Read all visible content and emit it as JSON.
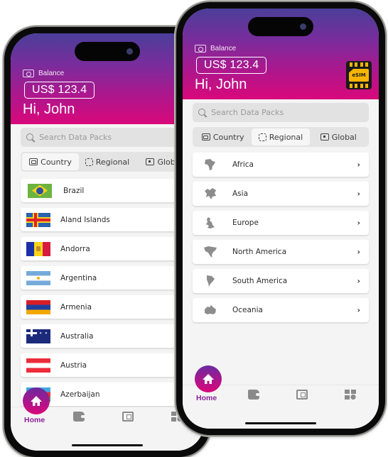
{
  "colors": {
    "gradient_top": "#4a3f9a",
    "gradient_bottom": "#d9087a",
    "home_label": "#8a1f96",
    "esim_chip": "#f7b500"
  },
  "header": {
    "balance_label": "Balance",
    "balance_value": "US$ 123.4",
    "greeting": "Hi, John",
    "esim_label": "eSIM"
  },
  "search": {
    "placeholder": "Search Data Packs"
  },
  "tabs": [
    {
      "label": "Country",
      "icon": "sim-card-icon"
    },
    {
      "label": "Regional",
      "icon": "chip-icon"
    },
    {
      "label": "Global",
      "icon": "globe-chip-icon"
    }
  ],
  "back_screen": {
    "active_tab": "Country",
    "countries": [
      {
        "name": "Brazil",
        "flag": "brazil"
      },
      {
        "name": "Aland Islands",
        "flag": "aland"
      },
      {
        "name": "Andorra",
        "flag": "andorra"
      },
      {
        "name": "Argentina",
        "flag": "argentina"
      },
      {
        "name": "Armenia",
        "flag": "armenia"
      },
      {
        "name": "Australia",
        "flag": "australia"
      },
      {
        "name": "Austria",
        "flag": "austria"
      },
      {
        "name": "Azerbaijan",
        "flag": "azerbaijan"
      }
    ]
  },
  "front_screen": {
    "active_tab": "Regional",
    "regions": [
      {
        "name": "Africa",
        "icon": "africa-map-icon"
      },
      {
        "name": "Asia",
        "icon": "asia-map-icon"
      },
      {
        "name": "Europe",
        "icon": "europe-map-icon"
      },
      {
        "name": "North America",
        "icon": "north-america-map-icon"
      },
      {
        "name": "South America",
        "icon": "south-america-map-icon"
      },
      {
        "name": "Oceania",
        "icon": "oceania-map-icon"
      }
    ]
  },
  "nav": {
    "home_label": "Home",
    "chevron": "›"
  }
}
